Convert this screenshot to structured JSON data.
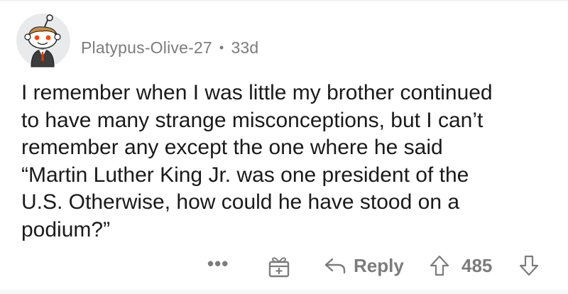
{
  "comment": {
    "username": "Platypus-Olive-27",
    "separator": "•",
    "age": "33d",
    "body_lines": [
      "I remember when I was little my brother continued",
      "to have many strange misconceptions, but I can’t",
      "remember any except the one where he said",
      "“Martin Luther King Jr. was one president of the",
      "U.S. Otherwise, how could he have stood on a",
      "podium?”"
    ]
  },
  "actions": {
    "more_label": "•••",
    "reply_label": "Reply",
    "score": "485"
  },
  "icons": {
    "avatar": "snoo-avatar",
    "more": "more-dots-icon",
    "award": "gift-award-icon",
    "reply": "reply-arrow-icon",
    "upvote": "upvote-arrow-icon",
    "downvote": "downvote-arrow-icon"
  },
  "colors": {
    "text": "#1a1a1b",
    "meta": "#7c7c7c",
    "avatar_bg": "#e9eaeb"
  }
}
